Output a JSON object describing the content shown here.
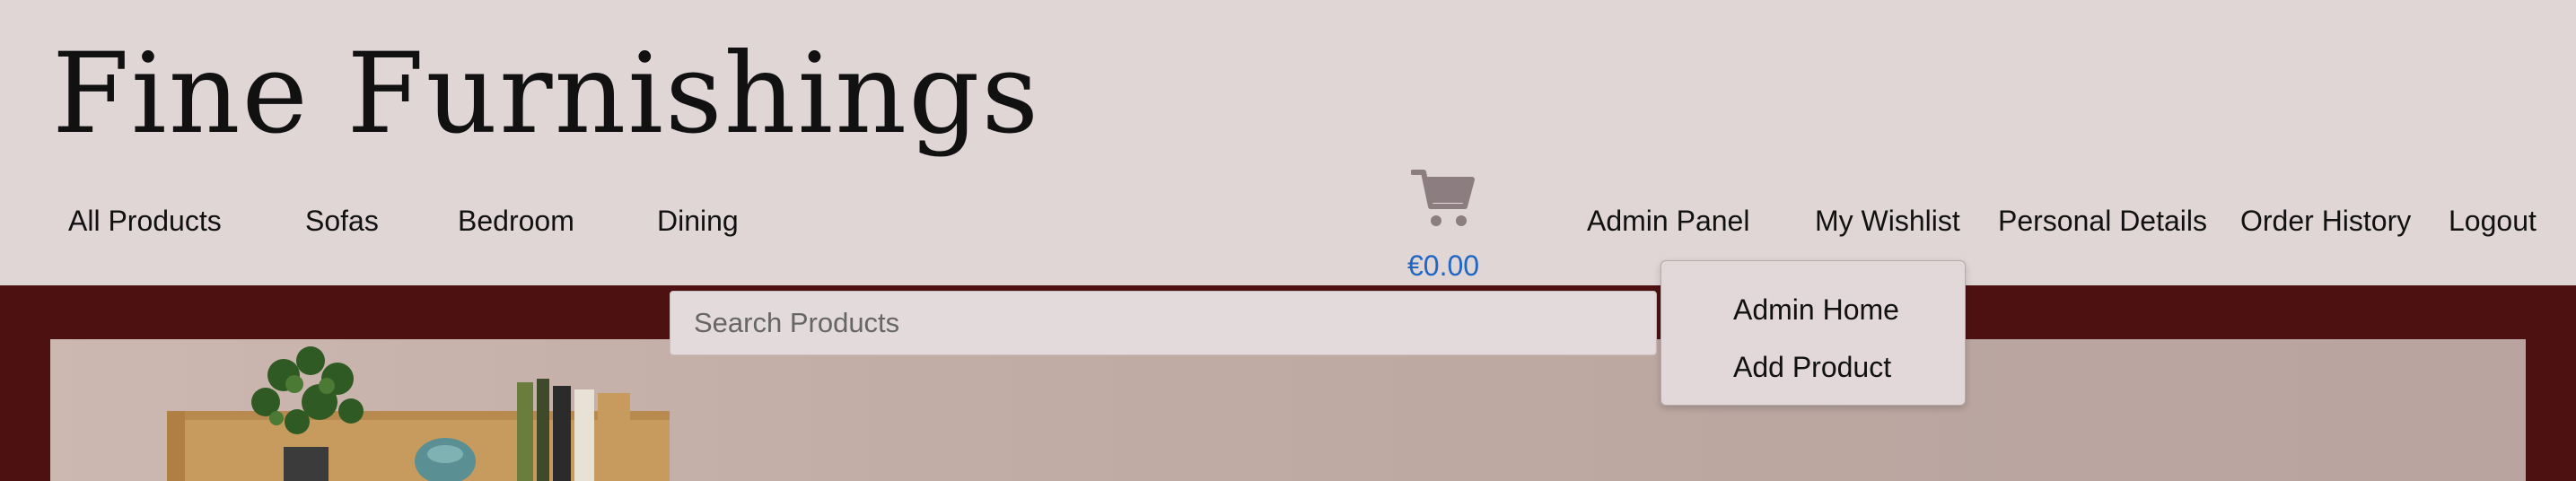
{
  "brand": {
    "name": "Fine Furnishings"
  },
  "nav": {
    "left": [
      "All Products",
      "Sofas",
      "Bedroom",
      "Dining"
    ],
    "right": [
      "Admin Panel",
      "My Wishlist",
      "Personal Details",
      "Order History",
      "Logout"
    ]
  },
  "cart": {
    "icon": "shopping-cart-icon",
    "total": "€0.00",
    "icon_color": "#8c7e80",
    "total_color": "#1f67c2"
  },
  "search": {
    "placeholder": "Search Products"
  },
  "admin_dropdown": {
    "items": [
      "Admin Home",
      "Add Product"
    ]
  },
  "colors": {
    "header_bg": "#e0d6d6",
    "band_bg": "#4d1111"
  }
}
